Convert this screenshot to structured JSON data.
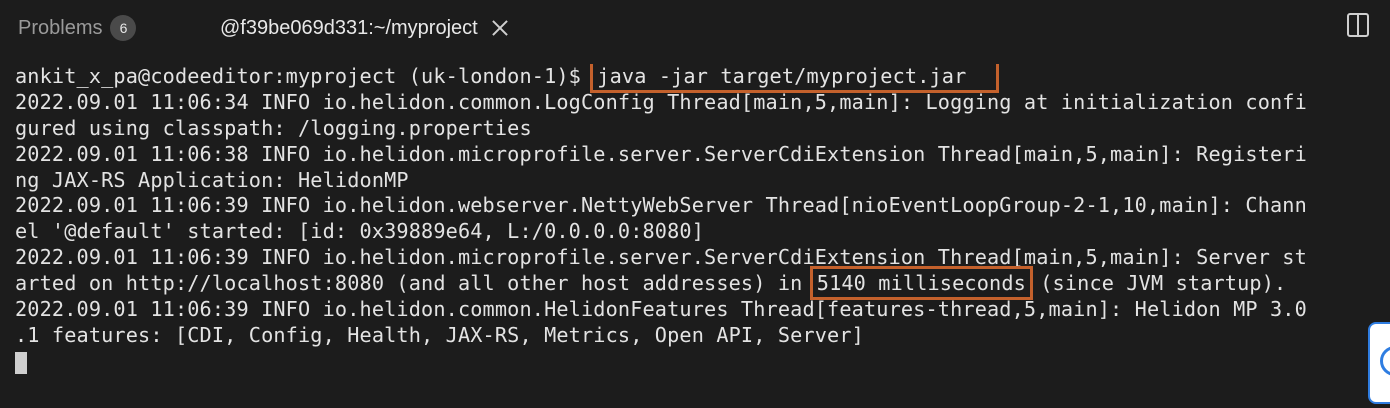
{
  "tabs": {
    "problems_label": "Problems",
    "problems_count": "6",
    "terminal_title": "@f39be069d331:~/myproject"
  },
  "terminal": {
    "prompt": "ankit_x_pa@codeeditor:myproject (uk-london-1)$ ",
    "command": "java -jar target/myproject.jar",
    "lines": [
      "2022.09.01 11:06:34 INFO io.helidon.common.LogConfig Thread[main,5,main]: Logging at initialization confi",
      "gured using classpath: /logging.properties",
      "2022.09.01 11:06:38 INFO io.helidon.microprofile.server.ServerCdiExtension Thread[main,5,main]: Registeri",
      "ng JAX-RS Application: HelidonMP",
      "2022.09.01 11:06:39 INFO io.helidon.webserver.NettyWebServer Thread[nioEventLoopGroup-2-1,10,main]: Chann",
      "el '@default' started: [id: 0x39889e64, L:/0.0.0.0:8080]",
      "2022.09.01 11:06:39 INFO io.helidon.microprofile.server.ServerCdiExtension Thread[main,5,main]: Server st"
    ],
    "startup_line": {
      "before": "arted on http://localhost:8080 (and all other host addresses) in ",
      "highlight": "5140 milliseconds",
      "after": " (since JVM startup)."
    },
    "lines_after": [
      "2022.09.01 11:06:39 INFO io.helidon.common.HelidonFeatures Thread[features-thread,5,main]: Helidon MP 3.0",
      ".1 features: [CDI, Config, Health, JAX-RS, Metrics, Open API, Server]"
    ]
  },
  "colors": {
    "background": "#1c1c1c",
    "text": "#e3e3e3",
    "highlight_box": "#c4612c"
  },
  "icons": {
    "close": "close-icon",
    "split": "split-editor-icon"
  }
}
